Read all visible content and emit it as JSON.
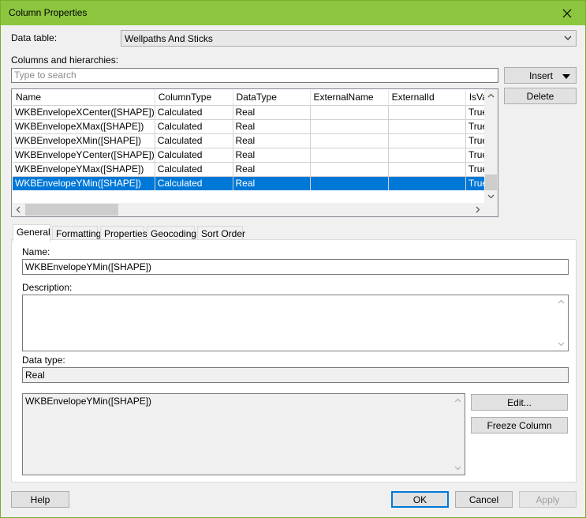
{
  "window": {
    "title": "Column Properties"
  },
  "data_table": {
    "label": "Data table:",
    "value": "Wellpaths And Sticks"
  },
  "columns_section": {
    "label": "Columns and hierarchies:",
    "search_placeholder": "Type to search"
  },
  "buttons": {
    "insert": "Insert",
    "delete": "Delete",
    "edit": "Edit...",
    "freeze": "Freeze Column",
    "help": "Help",
    "ok": "OK",
    "cancel": "Cancel",
    "apply": "Apply"
  },
  "grid": {
    "headers": [
      "Name",
      "ColumnType",
      "DataType",
      "ExternalName",
      "ExternalId",
      "IsValid"
    ],
    "rows": [
      [
        "WKBEnvelopeXCenter([SHAPE])",
        "Calculated",
        "Real",
        "",
        "",
        "True"
      ],
      [
        "WKBEnvelopeXMax([SHAPE])",
        "Calculated",
        "Real",
        "",
        "",
        "True"
      ],
      [
        "WKBEnvelopeXMin([SHAPE])",
        "Calculated",
        "Real",
        "",
        "",
        "True"
      ],
      [
        "WKBEnvelopeYCenter([SHAPE])",
        "Calculated",
        "Real",
        "",
        "",
        "True"
      ],
      [
        "WKBEnvelopeYMax([SHAPE])",
        "Calculated",
        "Real",
        "",
        "",
        "True"
      ],
      [
        "WKBEnvelopeYMin([SHAPE])",
        "Calculated",
        "Real",
        "",
        "",
        "True"
      ]
    ],
    "selected_row": 5
  },
  "tabs": [
    "General",
    "Formatting",
    "Properties",
    "Geocoding",
    "Sort Order"
  ],
  "active_tab": "General",
  "general": {
    "name_label": "Name:",
    "name_value": "WKBEnvelopeYMin([SHAPE])",
    "description_label": "Description:",
    "description_value": "",
    "datatype_label": "Data type:",
    "datatype_value": "Real",
    "expression": "WKBEnvelopeYMin([SHAPE])"
  },
  "colors": {
    "title_bar": "#8cc63f",
    "selection": "#0078d7"
  }
}
